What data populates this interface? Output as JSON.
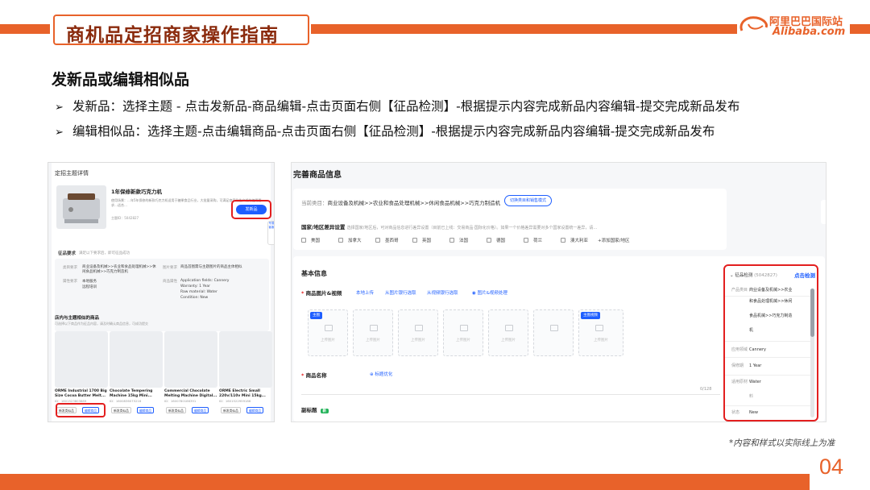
{
  "header": {
    "title": "商机品定招商家操作指南",
    "logo_cn": "阿里巴巴国际站",
    "logo_en": "Alibaba.com"
  },
  "section_title": "发新品或编辑相似品",
  "bullets": [
    "发新品：选择主题 - 点击发新品-商品编辑-点击页面右侧【征品检测】-根据提示内容完成新品内容编辑-提交完成新品发布",
    "编辑相似品：选择主题-点击编辑商品-点击页面右侧【征品检测】-根据提示内容完成新品内容编辑-提交完成新品发布"
  ],
  "bullet_marker": "➢",
  "footnote": "*内容和样式以实际线上为准",
  "page_number": "04",
  "left_shot": {
    "heading": "定招主题详情",
    "product_title": "1年保修新款巧克力机",
    "desc": "使用场景：…年5年保修的新款巧克力机适用于糖果食品行业，大批量采购，可满足商家及生产线的使用要求…适合…",
    "theme_id": "主题ID：5042827",
    "new_btn": "发新品",
    "side_tab": "专属客服",
    "req_title": "征品要求",
    "req_note": "满足以下要求后，即可征品成功",
    "cat_label": "类目要求",
    "cat_value": "商业设备及机械>>农业和食品处理机械>>休闲食品机械>>巧克力制造机",
    "img_label": "图片要求",
    "img_value": "商品首图需与主题图片的商品主体相似",
    "attr_label": "属性要求",
    "attr_k1": "本地服务",
    "attr_k2": "远程培训",
    "attr_list": [
      "Application fields: Cannery",
      "Warranty: 1 Year",
      "Raw material: Water",
      "Condition: New"
    ],
    "attr_label2": "商品属性",
    "similar_title": "店内与主题相似的商品",
    "similar_note": "可选择以下商品作为征品内容，请及时确认商品信息，可成功提交",
    "products": [
      {
        "name": "ORME Industrial 1700 Big Size Cocoa Butter Melt...",
        "id": "ID：1601523803889"
      },
      {
        "name": "Chocolate Tempering Machine 15kg Mini...",
        "id": "ID：1600836075216"
      },
      {
        "name": "Commercial Chocolate Melting Machine Digital...",
        "id": "ID：1600780186391"
      },
      {
        "name": "ORME Electric Small 220v/110v Mini 15kg...",
        "id": "ID：1601522959186"
      }
    ],
    "btn_similar": "新发类似品",
    "btn_edit": "编辑商品"
  },
  "right_shot": {
    "title": "完善商品信息",
    "cat_key": "当前类目：",
    "cat_value": "商业设备及机械>>农业和食品处理机械>>休闲食品机械>>巧克力制造机",
    "switch_btn": "切换类目和销售模式",
    "diff_title": "国家/地区差异设置",
    "diff_note": "选择国家/地区后，可对商品信息进行差异设置（目前已上线：交易商品·国际化价格）。如果一个价格差异需要对多个国家设置统一差异，请…",
    "countries": [
      "美国",
      "加拿大",
      "墨西哥",
      "英国",
      "法国",
      "德国",
      "荷兰",
      "澳大利亚",
      "+添加国家/地区"
    ],
    "basic": "基本信息",
    "img_label": "商品图片&视频",
    "links": [
      "本地上传",
      "从图片银行选取",
      "从视频银行选取",
      "图片&视频处理"
    ],
    "slot_caption": "上传图片",
    "tag_main": "主图",
    "tag_video": "主图视频",
    "name_label": "商品名称",
    "name_opt": "标题优化",
    "count": "0/128",
    "subtitle": "副标题",
    "subtitle_tag": "新",
    "panel": {
      "header": "征品检测",
      "id": "(5042827)",
      "check": "点击检测",
      "rows": [
        {
          "k": "产品类目",
          "v": "商业设备及机械>>农业"
        },
        {
          "k": "",
          "v": "和食品处理机械>>休闲"
        },
        {
          "k": "",
          "v": "食品机械>>巧克力制造"
        },
        {
          "k": "",
          "v": "机"
        },
        {
          "k": "应用领域",
          "v": "Cannery"
        },
        {
          "k": "保修期",
          "v": "1 Year"
        },
        {
          "k": "适用原材",
          "v": "Water"
        },
        {
          "k": "料",
          "v": ""
        },
        {
          "k": "状态",
          "v": "New"
        }
      ]
    }
  }
}
